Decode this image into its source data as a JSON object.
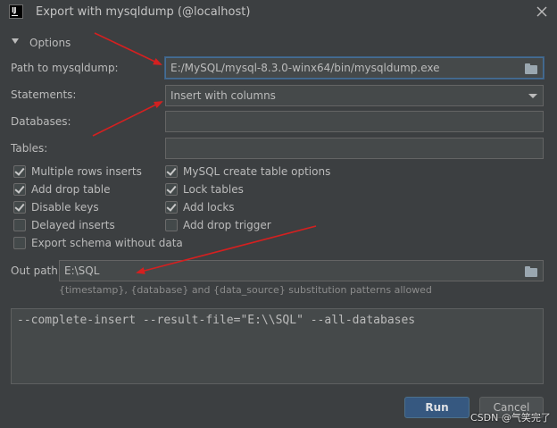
{
  "window": {
    "title": "Export with mysqldump (@localhost)"
  },
  "icons": {
    "app": "intellij-icon",
    "close": "close-icon",
    "folder": "folder-icon",
    "dropdown": "chevron-down-icon"
  },
  "options": {
    "section_label": "Options"
  },
  "form": {
    "path_label": "Path to mysqldump:",
    "path_value": "E:/MySQL/mysql-8.3.0-winx64/bin/mysqldump.exe",
    "statements_label": "Statements:",
    "statements_value": "Insert with columns",
    "databases_label": "Databases:",
    "databases_value": "",
    "tables_label": "Tables:",
    "tables_value": ""
  },
  "checkboxes": [
    {
      "label": "Multiple rows inserts",
      "checked": true
    },
    {
      "label": "Add drop table",
      "checked": true
    },
    {
      "label": "Disable keys",
      "checked": true
    },
    {
      "label": "Delayed inserts",
      "checked": false
    },
    {
      "label": "Export schema without data",
      "checked": false
    },
    {
      "label": "MySQL create table options",
      "checked": true
    },
    {
      "label": "Lock tables",
      "checked": true
    },
    {
      "label": "Add locks",
      "checked": true
    },
    {
      "label": "Add drop trigger",
      "checked": false
    }
  ],
  "out": {
    "label": "Out path:",
    "value": "E:\\SQL",
    "hint": "{timestamp}, {database} and {data_source} substitution patterns allowed"
  },
  "command": "--complete-insert --result-file=\"E:\\\\SQL\" --all-databases",
  "buttons": {
    "run": "Run",
    "cancel": "Cancel"
  },
  "watermark": "CSDN @气笑完了",
  "colors": {
    "background": "#3c3f41",
    "field": "#45494a",
    "primary_button": "#365880",
    "annotation_arrow": "#d42020"
  }
}
